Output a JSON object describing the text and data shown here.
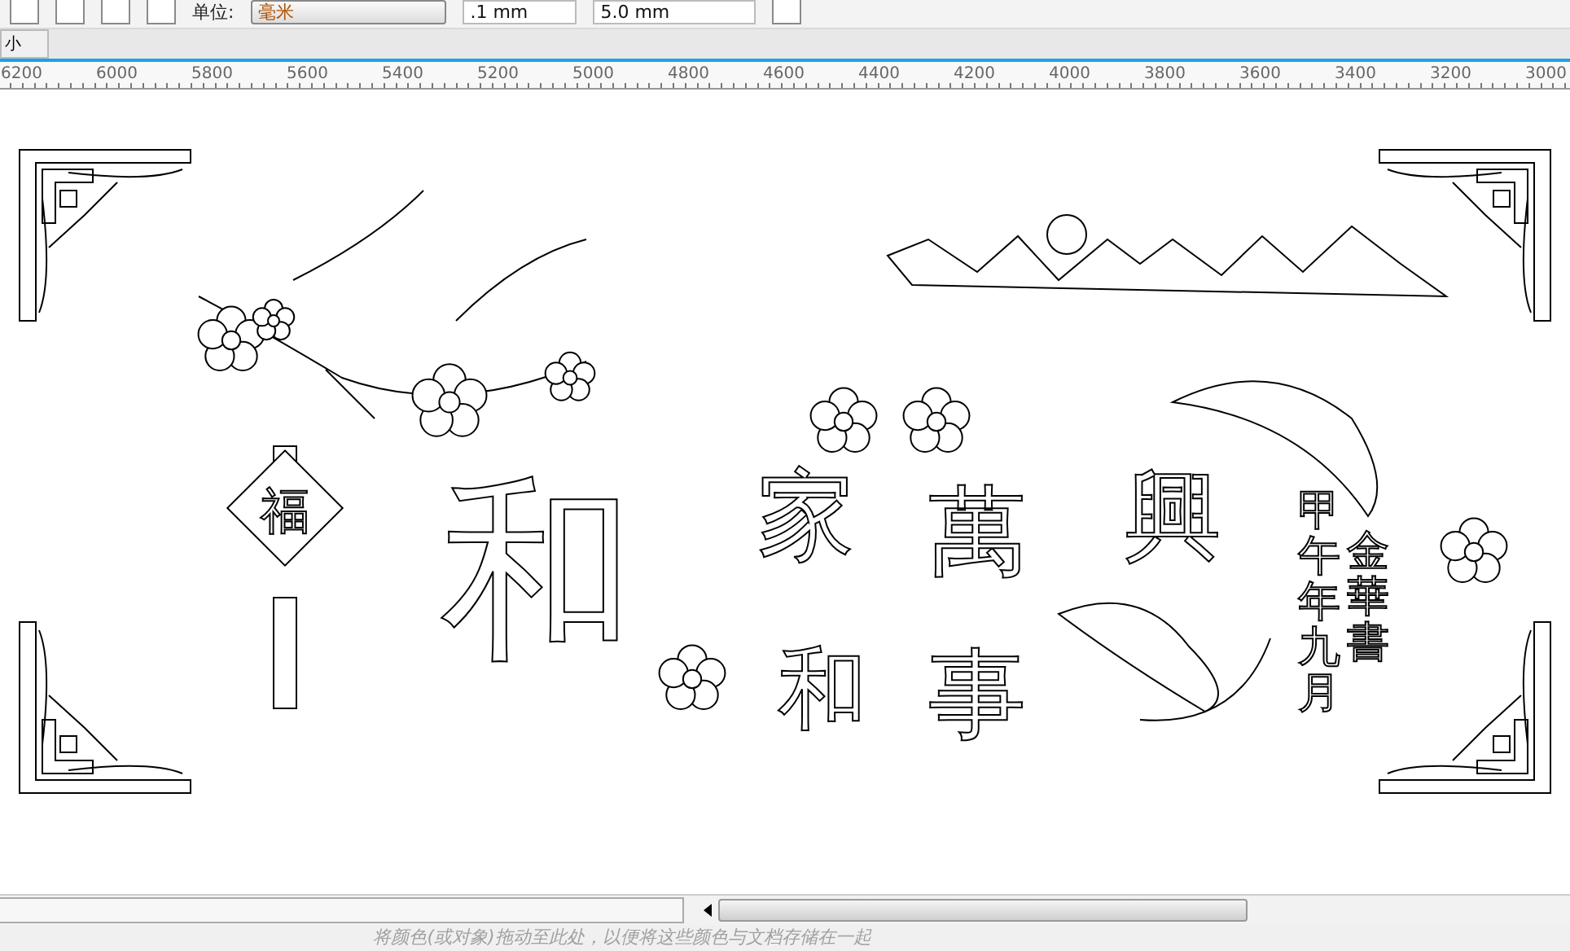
{
  "toolbar": {
    "unit_label": "单位:",
    "unit_value": "毫米",
    "nudge": ".1 mm",
    "duplicate": "5.0 mm"
  },
  "ruler": {
    "corner": "小",
    "labels": [
      "6200",
      "6000",
      "5800",
      "5600",
      "5400",
      "5200",
      "5000",
      "4800",
      "4600",
      "4400",
      "4200",
      "4000",
      "3800",
      "3600",
      "3400",
      "3200",
      "3000"
    ]
  },
  "artwork": {
    "texts": [
      {
        "kind": "big",
        "text": "和"
      },
      {
        "kind": "diamond",
        "text": "福"
      },
      {
        "kind": "medium",
        "text": "家"
      },
      {
        "kind": "medium",
        "text": "和"
      },
      {
        "kind": "medium",
        "text": "萬"
      },
      {
        "kind": "medium",
        "text": "事"
      },
      {
        "kind": "medium",
        "text": "興"
      },
      {
        "kind": "column",
        "text": "甲午年九月"
      },
      {
        "kind": "column",
        "text": "金華書"
      }
    ]
  },
  "status_bar": {
    "hint": "将颜色(或对象)拖动至此处，以便将这些颜色与文档存储在一起"
  }
}
